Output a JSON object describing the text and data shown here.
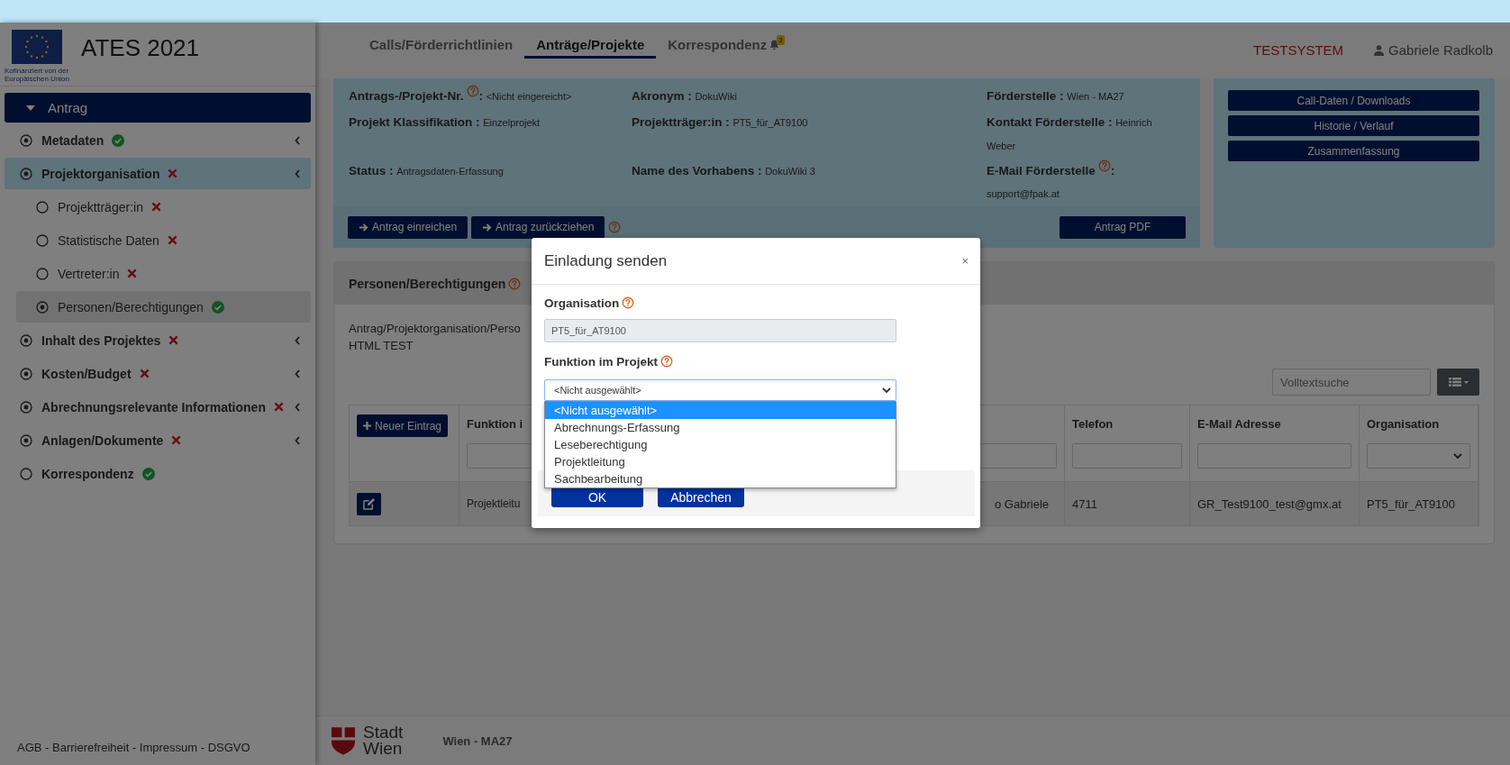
{
  "top_nav": {
    "tabs": [
      {
        "label": "Calls/Förderrichtlinien",
        "selected": false
      },
      {
        "label": "Anträge/Projekte",
        "selected": true
      },
      {
        "label": "Korrespondenz",
        "selected": false,
        "badge": "3"
      }
    ],
    "environment": "TESTSYSTEM",
    "user": "Gabriele Radkolb"
  },
  "sidebar": {
    "logo_caption": [
      "Kofinanziert von der",
      "Europäischen Union"
    ],
    "app_title": "ATES 2021",
    "section": {
      "label": "Antrag",
      "expanded": true
    },
    "items": [
      {
        "label": "Metadaten",
        "complete": true,
        "filled": true,
        "selected": false,
        "expandable": true
      },
      {
        "label": "Projektorganisation",
        "complete": false,
        "filled": true,
        "selected": true,
        "expandable": true,
        "children": [
          {
            "label": "Projektträger:in",
            "complete": false,
            "filled": false,
            "selected": false
          },
          {
            "label": "Statistische Daten",
            "complete": false,
            "filled": false,
            "selected": false
          },
          {
            "label": "Vertreter:in",
            "complete": false,
            "filled": false,
            "selected": false
          },
          {
            "label": "Personen/Berechtigungen",
            "complete": true,
            "filled": true,
            "selected": true
          }
        ]
      },
      {
        "label": "Inhalt des Projektes",
        "complete": false,
        "filled": true,
        "selected": false,
        "expandable": true
      },
      {
        "label": "Kosten/Budget",
        "complete": false,
        "filled": true,
        "selected": false,
        "expandable": true
      },
      {
        "label": "Abrechnungsrelevante Informationen",
        "complete": false,
        "filled": true,
        "selected": false,
        "expandable": true
      },
      {
        "label": "Anlagen/Dokumente",
        "complete": false,
        "filled": true,
        "selected": false,
        "expandable": true
      },
      {
        "label": "Korrespondenz",
        "complete": true,
        "filled": false,
        "selected": false,
        "expandable": false
      }
    ],
    "footer_links": "AGB - Barrierefreiheit - Impressum - DSGVO"
  },
  "info": {
    "rows": [
      [
        {
          "label": "Antrags-/Projekt-Nr.",
          "help": true,
          "after_help": ":",
          "value": "<Nicht eingereicht>"
        },
        {
          "label": "Akronym :",
          "help": false,
          "value": "DokuWiki"
        },
        {
          "label": "Förderstelle :",
          "help": false,
          "value": "Wien - MA27"
        }
      ],
      [
        {
          "label": "Projekt Klassifikation :",
          "help": false,
          "value": "Einzelprojekt"
        },
        {
          "label": "Projektträger:in :",
          "help": false,
          "value": "PT5_für_AT9100"
        },
        {
          "label": "Kontakt Förderstelle :",
          "help": false,
          "value": "Heinrich Weber"
        }
      ],
      [
        {
          "label": "Status :",
          "help": false,
          "value": "Antragsdaten-Erfassung"
        },
        {
          "label": "Name des Vorhabens :",
          "help": false,
          "value": "DokuWiki 3"
        },
        {
          "label": "E-Mail Förderstelle",
          "help": true,
          "after_help": ":",
          "value": "support@fpak.at"
        }
      ]
    ],
    "actions": [
      {
        "label": "Antrag einreichen"
      },
      {
        "label": "Antrag zurückziehen"
      }
    ],
    "actions_help": true,
    "pdf_button": "Antrag PDF"
  },
  "side_buttons": [
    "Call-Daten / Downloads",
    "Historie / Verlauf",
    "Zusammenfassung"
  ],
  "persons": {
    "title": "Personen/Berechtigungen",
    "help": true,
    "breadcrumb": "Antrag/Projektorganisation/Perso",
    "note": "HTML TEST",
    "search": {
      "placeholder": "Volltextsuche"
    },
    "new_button": "Neuer Eintrag",
    "columns": [
      {
        "label": "Funktion i",
        "kind": "text"
      },
      {
        "kind": "text"
      },
      {
        "label": "Telefon",
        "kind": "text"
      },
      {
        "label": "E-Mail Adresse",
        "kind": "text"
      },
      {
        "label": "Organisation",
        "kind": "select"
      }
    ],
    "rows": [
      {
        "cells": [
          "Projektleitu",
          "o Gabriele",
          "4711",
          "GR_Test9100_test@gmx.at",
          "PT5_für_AT9100"
        ]
      }
    ]
  },
  "footer": {
    "logo_lines": [
      "Stadt",
      "Wien"
    ],
    "office": "Wien - MA27"
  },
  "modal": {
    "title": "Einladung senden",
    "close": "×",
    "organisation": {
      "label": "Organisation",
      "help": true,
      "value": "PT5_für_AT9100",
      "disabled": true
    },
    "function": {
      "label": "Funktion im Projekt",
      "help": true,
      "value": "<Nicht ausgewählt>",
      "expanded": true,
      "options": [
        {
          "label": "<Nicht ausgewählt>",
          "selected": true
        },
        {
          "label": "Abrechnungs-Erfassung",
          "selected": false
        },
        {
          "label": "Leseberechtigung",
          "selected": false
        },
        {
          "label": "Projektleitung",
          "selected": false
        },
        {
          "label": "Sachbearbeitung",
          "selected": false
        }
      ]
    },
    "buttons": [
      "OK",
      "Abbrechen"
    ]
  }
}
